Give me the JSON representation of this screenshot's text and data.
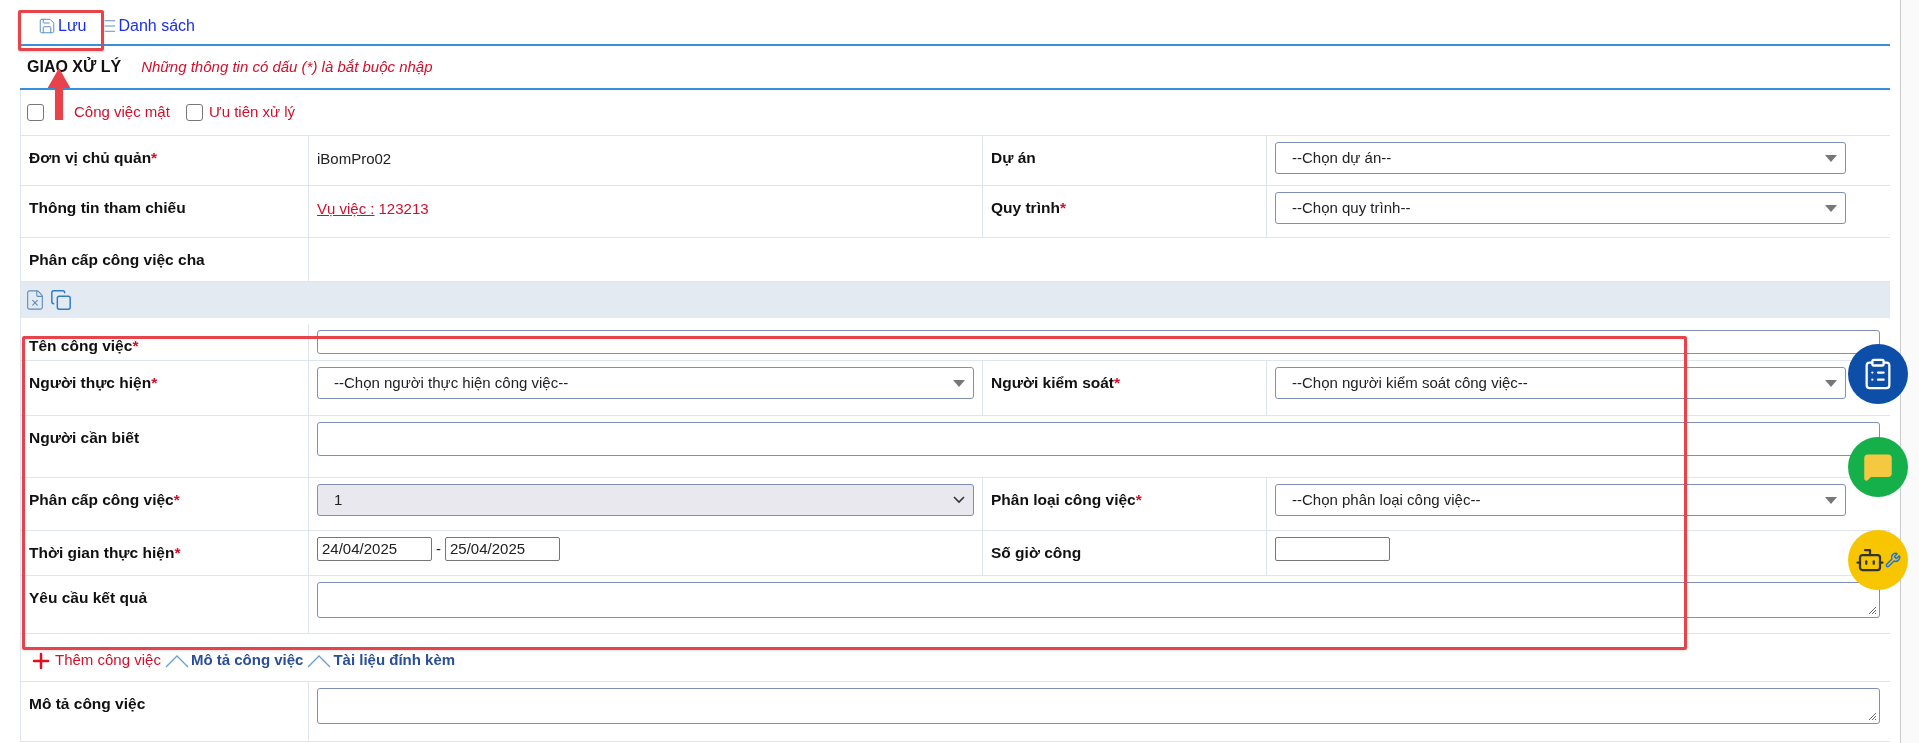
{
  "toolbar": [
    {
      "kind": "save",
      "label": "Lưu"
    },
    {
      "kind": "list",
      "label": "Danh sách"
    }
  ],
  "header": {
    "title": "GIAO XỬ LÝ",
    "note": "Những thông tin có dấu (*) là bắt buộc nhập"
  },
  "checkboxes": [
    {
      "label": "Công việc mật",
      "checked": false
    },
    {
      "label": "Ưu tiên xử lý",
      "checked": false
    }
  ],
  "info_rows": [
    {
      "fields": [
        {
          "label": "Đơn vị chủ quản",
          "mark": "*",
          "kind": "text",
          "value": "iBomPro02"
        },
        {
          "label": "Dự án",
          "kind": "select",
          "value": "--Chọn dự án--",
          "disabled": false
        }
      ]
    },
    {
      "fields": [
        {
          "label": "Thông tin tham chiếu",
          "kind": "reference",
          "link": "Vụ việc :",
          "value": "123213"
        },
        {
          "label": "Quy trình",
          "mark": "*",
          "kind": "select",
          "value": "--Chọn quy trình--",
          "disabled": false
        }
      ]
    },
    {
      "fields": [
        {
          "label": "Phân cấp công việc cha",
          "kind": "empty"
        }
      ]
    }
  ],
  "task_rows": [
    {
      "fields": [
        {
          "label": "Tên công việc",
          "mark": "*",
          "kind": "input"
        }
      ]
    },
    {
      "fields": [
        {
          "label": "Người thực hiện",
          "mark": "*",
          "kind": "select",
          "value": "--Chọn người thực hiện công việc--",
          "disabled": false
        },
        {
          "label": "Người kiểm soát",
          "mark": "*",
          "kind": "select",
          "value": "--Chọn người kiểm soát công việc--",
          "disabled": false
        }
      ]
    },
    {
      "fields": [
        {
          "label": "Người cần biết",
          "kind": "tall_input"
        }
      ]
    },
    {
      "fields": [
        {
          "label": "Phân cấp công việc",
          "mark": "*",
          "kind": "select",
          "value": "1",
          "disabled": true
        },
        {
          "label": "Phân loại công việc",
          "mark": "*",
          "kind": "select",
          "value": "--Chọn phân loại công việc--",
          "disabled": false
        }
      ]
    },
    {
      "fields": [
        {
          "label": "Thời gian thực hiện",
          "mark": "*",
          "kind": "date_range",
          "from": "24/04/2025",
          "separator": "-",
          "to": "25/04/2025"
        },
        {
          "label": "Số giờ công",
          "kind": "short_input"
        }
      ]
    },
    {
      "fields": [
        {
          "label": "Yêu cầu kết quả",
          "kind": "textarea"
        }
      ]
    }
  ],
  "actions": [
    {
      "kind": "add",
      "label": "Thêm công việc"
    },
    {
      "kind": "toggle",
      "label": "Mô tả công việc"
    },
    {
      "kind": "toggle",
      "label": "Tài liệu đính kèm"
    }
  ],
  "description_rows": [
    {
      "fields": [
        {
          "label": "Mô tả công việc",
          "kind": "textarea"
        }
      ]
    }
  ]
}
